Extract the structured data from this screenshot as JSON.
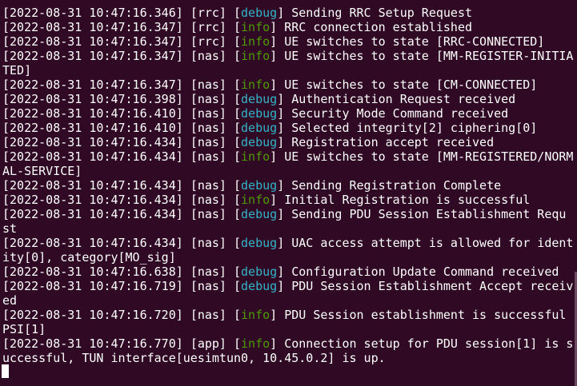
{
  "terminal": {
    "lines": [
      {
        "ts": "[2022-08-31 10:47:16.346]",
        "mod": "[rrc]",
        "lvl": "debug",
        "msg": "Sending RRC Setup Request",
        "cont": ""
      },
      {
        "ts": "[2022-08-31 10:47:16.347]",
        "mod": "[rrc]",
        "lvl": "info",
        "msg": "RRC connection established",
        "cont": ""
      },
      {
        "ts": "[2022-08-31 10:47:16.347]",
        "mod": "[rrc]",
        "lvl": "info",
        "msg": "UE switches to state [RRC-CONNECTED]",
        "cont": ""
      },
      {
        "ts": "[2022-08-31 10:47:16.347]",
        "mod": "[nas]",
        "lvl": "info",
        "msg": "UE switches to state [MM-REGISTER-INITIA",
        "cont": "TED]"
      },
      {
        "ts": "[2022-08-31 10:47:16.347]",
        "mod": "[nas]",
        "lvl": "info",
        "msg": "UE switches to state [CM-CONNECTED]",
        "cont": ""
      },
      {
        "ts": "[2022-08-31 10:47:16.398]",
        "mod": "[nas]",
        "lvl": "debug",
        "msg": "Authentication Request received",
        "cont": ""
      },
      {
        "ts": "[2022-08-31 10:47:16.410]",
        "mod": "[nas]",
        "lvl": "debug",
        "msg": "Security Mode Command received",
        "cont": ""
      },
      {
        "ts": "[2022-08-31 10:47:16.410]",
        "mod": "[nas]",
        "lvl": "debug",
        "msg": "Selected integrity[2] ciphering[0]",
        "cont": ""
      },
      {
        "ts": "[2022-08-31 10:47:16.434]",
        "mod": "[nas]",
        "lvl": "debug",
        "msg": "Registration accept received",
        "cont": ""
      },
      {
        "ts": "[2022-08-31 10:47:16.434]",
        "mod": "[nas]",
        "lvl": "info",
        "msg": "UE switches to state [MM-REGISTERED/NORM",
        "cont": "AL-SERVICE]"
      },
      {
        "ts": "[2022-08-31 10:47:16.434]",
        "mod": "[nas]",
        "lvl": "debug",
        "msg": "Sending Registration Complete",
        "cont": ""
      },
      {
        "ts": "[2022-08-31 10:47:16.434]",
        "mod": "[nas]",
        "lvl": "info",
        "msg": "Initial Registration is successful",
        "cont": ""
      },
      {
        "ts": "[2022-08-31 10:47:16.434]",
        "mod": "[nas]",
        "lvl": "debug",
        "msg": "Sending PDU Session Establishment Requ",
        "cont": "st"
      },
      {
        "ts": "[2022-08-31 10:47:16.434]",
        "mod": "[nas]",
        "lvl": "debug",
        "msg": "UAC access attempt is allowed for ident",
        "cont": "ity[0], category[MO_sig]"
      },
      {
        "ts": "[2022-08-31 10:47:16.638]",
        "mod": "[nas]",
        "lvl": "debug",
        "msg": "Configuration Update Command received",
        "cont": ""
      },
      {
        "ts": "[2022-08-31 10:47:16.719]",
        "mod": "[nas]",
        "lvl": "debug",
        "msg": "PDU Session Establishment Accept receiv",
        "cont": "ed"
      },
      {
        "ts": "[2022-08-31 10:47:16.720]",
        "mod": "[nas]",
        "lvl": "info",
        "msg": "PDU Session establishment is successful",
        "cont": "PSI[1]"
      },
      {
        "ts": "[2022-08-31 10:47:16.770]",
        "mod": "[app]",
        "lvl": "info",
        "msg": "Connection setup for PDU session[1] is s",
        "cont": "uccessful, TUN interface[uesimtun0, 10.45.0.2] is up."
      }
    ]
  },
  "colors": {
    "background": "#300a24",
    "text": "#ffffff",
    "debug": "#34b2c8",
    "info": "#4e9a06"
  }
}
